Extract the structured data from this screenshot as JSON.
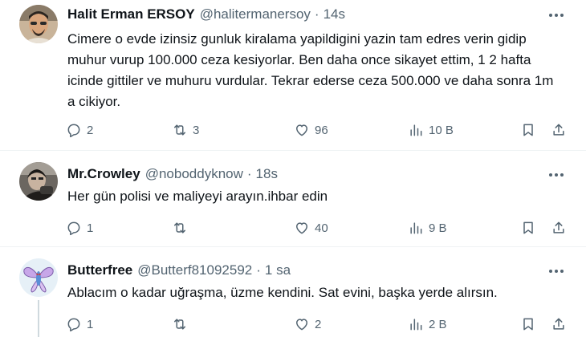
{
  "tweets": [
    {
      "name": "Halit Erman ERSOY",
      "handle": "@halitermanersoy",
      "separator": "·",
      "time": "14s",
      "text": "Cimere o evde izinsiz gunluk kiralama yapildigini yazin tam edres verin gidip muhur vurup 100.000 ceza kesiyorlar. Ben daha once sikayet ettim, 1 2 hafta icinde gittiler ve muhuru vurdular. Tekrar ederse ceza 500.000 ve daha sonra 1m a cikiyor.",
      "replies": "2",
      "retweets": "3",
      "likes": "96",
      "views": "10 B"
    },
    {
      "name": "Mr.Crowley",
      "handle": "@noboddyknow",
      "separator": "·",
      "time": "18s",
      "text": "Her gün polisi ve maliyeyi arayın.ihbar edin",
      "replies": "1",
      "retweets": "",
      "likes": "40",
      "views": "9 B"
    },
    {
      "name": "Butterfree",
      "handle": "@Butterf81092592",
      "separator": "·",
      "time": "1 sa",
      "text": "Ablacım o kadar uğraşma, üzme kendini. Sat evini, başka yerde alırsın.",
      "replies": "1",
      "retweets": "",
      "likes": "2",
      "views": "2 B"
    }
  ],
  "icons": {
    "reply": "reply-icon",
    "retweet": "retweet-icon",
    "like": "heart-icon",
    "views": "views-icon",
    "bookmark": "bookmark-icon",
    "share": "share-icon",
    "more": "more-icon"
  },
  "colors": {
    "text": "#0f1419",
    "secondary": "#536471",
    "divider": "#eff3f4"
  }
}
